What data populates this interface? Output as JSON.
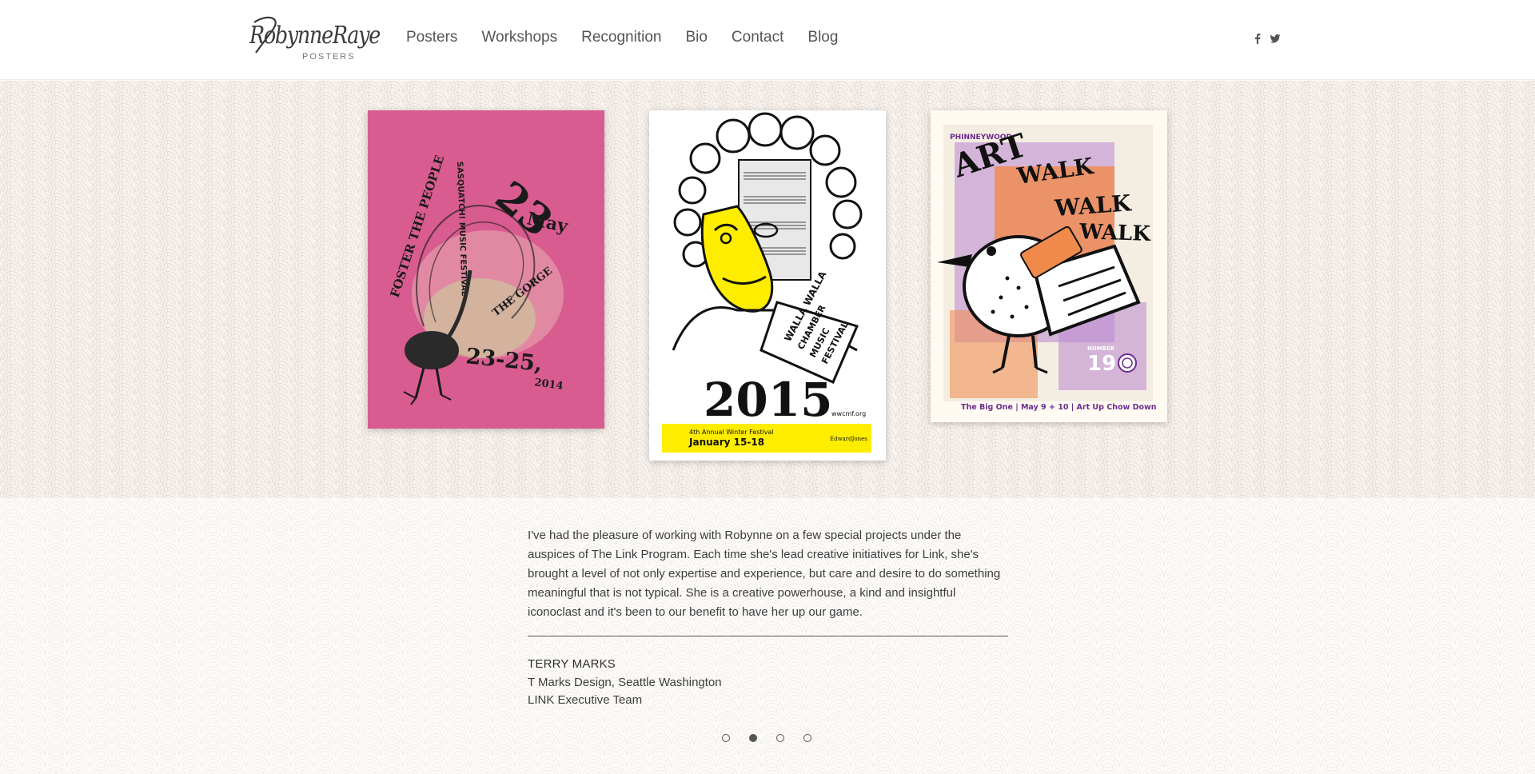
{
  "header": {
    "logo_script": "RobynneRaye",
    "logo_sub": "POSTERS",
    "nav": [
      "Posters",
      "Workshops",
      "Recognition",
      "Bio",
      "Contact",
      "Blog"
    ],
    "social": [
      "facebook-icon",
      "twitter-icon"
    ]
  },
  "posters": [
    {
      "name": "sasquatch-music-festival-poster",
      "bg": "#d85c8f",
      "lines": [
        "23",
        "May",
        "SASQUATCH! MUSIC FESTIVAL",
        "FOSTER THE PEOPLE",
        "THE GORGE",
        "23-25,",
        "2014"
      ]
    },
    {
      "name": "walla-walla-chamber-music-festival-poster",
      "year": "2015",
      "site": "wwcmf.org",
      "banner_line1": "4th Annual Winter Festival",
      "banner_line2": "January 15-18",
      "sponsor": "EdwardJones",
      "sash": [
        "WALLA WALLA",
        "CHAMBER",
        "MUSIC",
        "FESTIVAL"
      ]
    },
    {
      "name": "phinney-wood-art-walk-poster",
      "brand": "PHINNEYWOOD",
      "title": [
        "ART",
        "WALK",
        "WALK",
        "WALK"
      ],
      "number_label": "NUMBER",
      "number": "19",
      "footer": "The Big One | May 9 + 10 | Art Up Chow Down"
    }
  ],
  "testimonial": {
    "quote": "I've had the pleasure of working with Robynne on a few special projects under the auspices of The Link Program. Each time she's lead creative initiatives for Link, she's brought a level of not only expertise and experience, but care and desire to do something meaningful that is not typical. She is a creative powerhouse, a kind and insightful iconoclast and it's been to our benefit to have her up our game.",
    "author": "TERRY MARKS",
    "company": "T Marks Design, Seattle Washington",
    "role": "LINK Executive Team"
  },
  "slider": {
    "count": 4,
    "active": 2
  },
  "colors": {
    "nav_text": "#555555",
    "pink": "#d85c8f",
    "yellow": "#ffed00",
    "purple": "#6b2c8f",
    "orange": "#f08a4b"
  }
}
